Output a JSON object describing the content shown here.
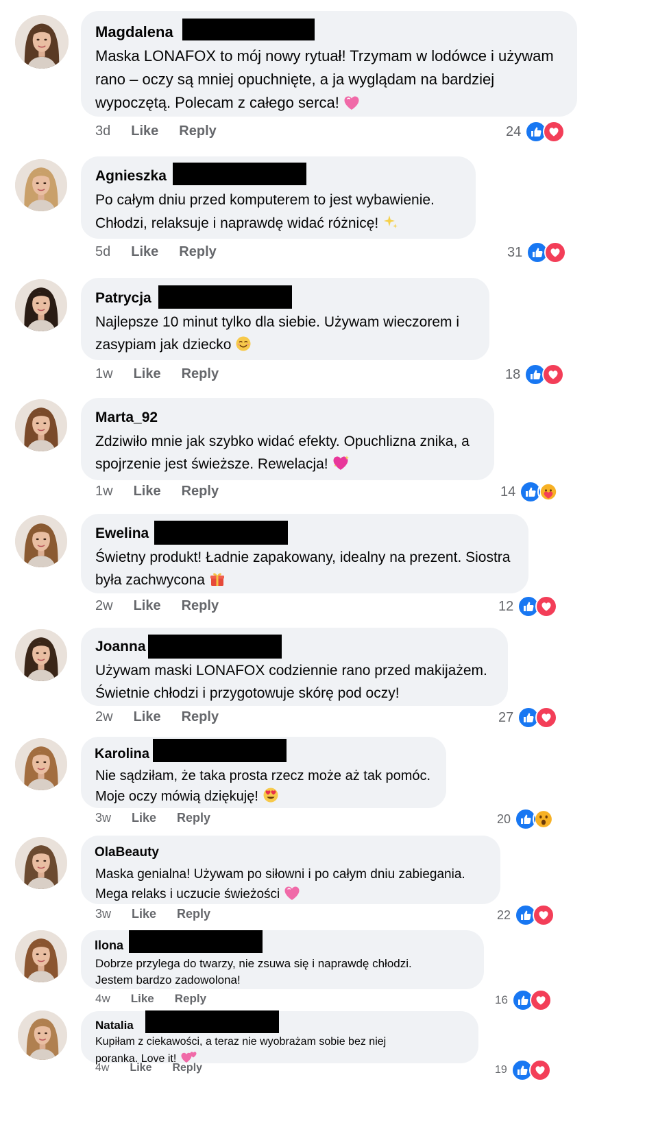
{
  "colors": {
    "bubble": "#f0f2f5",
    "like_blue": "#1877f2",
    "love_red": "#f33e58",
    "meta_gray": "#65676b"
  },
  "actions": {
    "like": "Like",
    "reply": "Reply"
  },
  "comments": [
    {
      "author": "Magdalena",
      "lines": [
        "Maska LONAFOX to mój nowy rytuał! Trzymam w lodówce i używam",
        "rano – oczy są mniej opuchnięte, a ja wyglądam na bardziej",
        "wypoczętą. Polecam z całego serca!"
      ],
      "emoji": "pink-heart",
      "time": "3d",
      "count": "24",
      "reactions": [
        "like",
        "love"
      ]
    },
    {
      "author": "Agnieszka",
      "lines": [
        "Po całym dniu przed komputerem to jest wybawienie.",
        "Chłodzi, relaksuje i naprawdę widać różnicę!"
      ],
      "emoji": "sparkles",
      "time": "5d",
      "count": "31",
      "reactions": [
        "like",
        "love"
      ]
    },
    {
      "author": "Patrycja",
      "lines": [
        "Najlepsze 10 minut tylko dla siebie. Używam wieczorem i",
        "zasypiam jak dziecko"
      ],
      "emoji": "smiling-face",
      "time": "1w",
      "count": "18",
      "reactions": [
        "like",
        "love"
      ]
    },
    {
      "author": "Marta_92",
      "lines": [
        "Zdziwiło mnie jak szybko widać efekty. Opuchlizna znika, a",
        "spojrzenie jest świeższe. Rewelacja!"
      ],
      "emoji": "sparkling-heart",
      "time": "1w",
      "count": "14",
      "reactions": [
        "like",
        "care"
      ]
    },
    {
      "author": "Ewelina",
      "lines": [
        "Świetny produkt! Ładnie zapakowany, idealny na prezent. Siostra",
        "była zachwycona"
      ],
      "emoji": "gift",
      "time": "2w",
      "count": "12",
      "reactions": [
        "like",
        "love"
      ]
    },
    {
      "author": "Joanna",
      "lines": [
        "Używam maski LONAFOX codziennie rano przed makijażem.",
        "Świetnie chłodzi i przygotowuje skórę pod oczy!"
      ],
      "emoji": "",
      "time": "2w",
      "count": "27",
      "reactions": [
        "like",
        "love"
      ]
    },
    {
      "author": "Karolina",
      "lines": [
        "Nie sądziłam, że taka prosta rzecz może aż tak pomóc.",
        "Moje oczy mówią dziękuję!"
      ],
      "emoji": "heart-eyes",
      "time": "3w",
      "count": "20",
      "reactions": [
        "like",
        "wow"
      ]
    },
    {
      "author": "OlaBeauty",
      "lines": [
        "Maska genialna! Używam po siłowni i po całym dniu zabiegania.",
        "Mega relaks i uczucie świeżości"
      ],
      "emoji": "pink-heart",
      "time": "3w",
      "count": "22",
      "reactions": [
        "like",
        "love"
      ]
    },
    {
      "author": "Ilona",
      "lines": [
        "Dobrze przylega do twarzy, nie zsuwa się i naprawdę chłodzi.",
        "Jestem bardzo zadowolona!"
      ],
      "emoji": "",
      "time": "4w",
      "count": "16",
      "reactions": [
        "like",
        "love"
      ]
    },
    {
      "author": "Natalia",
      "lines": [
        "Kupiłam z ciekawości, a teraz nie wyobrażam sobie bez niej",
        "poranka. Love it!"
      ],
      "emoji": "two-hearts",
      "time": "4w",
      "count": "19",
      "reactions": [
        "like",
        "love"
      ]
    }
  ]
}
